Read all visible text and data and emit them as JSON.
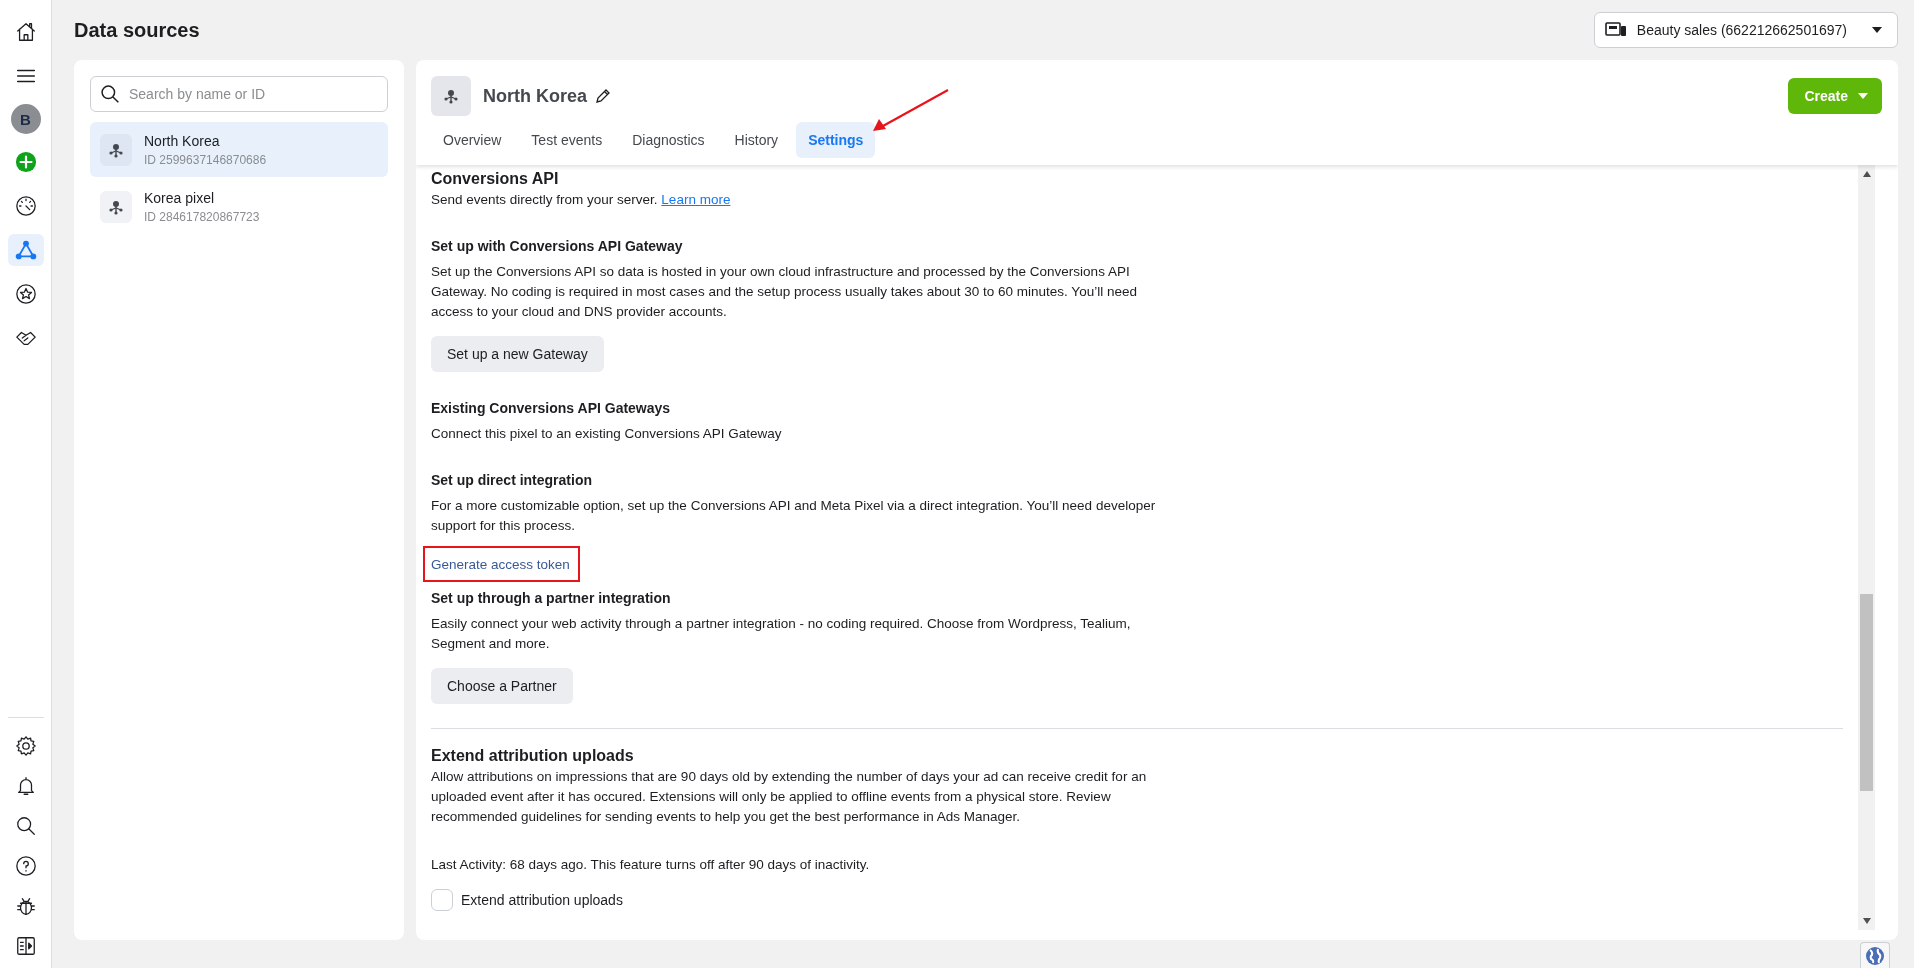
{
  "rail": {
    "top": [
      {
        "kind": "home",
        "selected": false
      },
      {
        "kind": "menu",
        "selected": false
      },
      {
        "kind": "avatar",
        "label": "B",
        "selected": false
      },
      {
        "kind": "add",
        "selected": false
      },
      {
        "kind": "gauge",
        "selected": false
      },
      {
        "kind": "network",
        "selected": true
      },
      {
        "kind": "star",
        "selected": false
      },
      {
        "kind": "handshake",
        "selected": false
      }
    ],
    "bottom": [
      {
        "kind": "settings",
        "selected": false
      },
      {
        "kind": "bell",
        "selected": false
      },
      {
        "kind": "search",
        "selected": false
      },
      {
        "kind": "help",
        "selected": false
      },
      {
        "kind": "bug",
        "selected": false
      },
      {
        "kind": "panel",
        "selected": false
      }
    ]
  },
  "page_title": "Data sources",
  "account": {
    "label": "Beauty sales (662212662501697)"
  },
  "sources": {
    "search": {
      "placeholder": "Search by name or ID"
    },
    "items": [
      {
        "name": "North Korea",
        "id": "ID 2599637146870686",
        "selected": true
      },
      {
        "name": "Korea pixel",
        "id": "ID 284617820867723",
        "selected": false
      }
    ]
  },
  "detail": {
    "name": "North Korea",
    "create_button": "Create",
    "tabs": [
      {
        "label": "Overview",
        "selected": false,
        "annotated": false
      },
      {
        "label": "Test events",
        "selected": false,
        "annotated": false
      },
      {
        "label": "Diagnostics",
        "selected": false,
        "annotated": false
      },
      {
        "label": "History",
        "selected": false,
        "annotated": false
      },
      {
        "label": "Settings",
        "selected": true,
        "annotated": true
      }
    ],
    "blocks": [
      {
        "kind": "title",
        "text": "Conversions API"
      },
      {
        "kind": "text_link",
        "text": "Send events directly from your server.",
        "link": "Learn more"
      },
      {
        "kind": "subheading",
        "text": "Set up with Conversions API Gateway"
      },
      {
        "kind": "text",
        "text": "Set up the Conversions API so data is hosted in your own cloud infrastructure and processed by the Conversions API Gateway. No coding is required in most cases and the setup process usually takes about 30 to 60 minutes. You’ll need access to your cloud and DNS provider accounts."
      },
      {
        "kind": "button",
        "text": "Set up a new Gateway"
      },
      {
        "kind": "subheading",
        "text": "Existing Conversions API Gateways"
      },
      {
        "kind": "text",
        "text": "Connect this pixel to an existing Conversions API Gateway"
      },
      {
        "kind": "subheading",
        "text": "Set up direct integration"
      },
      {
        "kind": "text",
        "text": "For a more customizable option, set up the Conversions API and Meta Pixel via a direct integration. You’ll need developer support for this process."
      },
      {
        "kind": "link",
        "text": "Generate access token",
        "annotated": true
      },
      {
        "kind": "subheading",
        "text": "Set up through a partner integration"
      },
      {
        "kind": "text",
        "text": "Easily connect your web activity through a partner integration - no coding required. Choose from Wordpress, Tealium, Segment and more."
      },
      {
        "kind": "button",
        "text": "Choose a Partner"
      },
      {
        "kind": "divider"
      },
      {
        "kind": "title",
        "text": "Extend attribution uploads"
      },
      {
        "kind": "text",
        "text": "Allow attributions on impressions that are 90 days old by extending the number of days your ad can receive credit for an uploaded event after it has occured. Extensions will only be applied to offline events from a physical store. Review recommended guidelines for sending events to help you get the best performance in Ads Manager."
      },
      {
        "kind": "note",
        "text": "Last Activity: 68 days ago. This feature turns off after 90 days of inactivity."
      },
      {
        "kind": "checkbox",
        "text": "Extend attribution uploads",
        "checked": false
      }
    ]
  }
}
